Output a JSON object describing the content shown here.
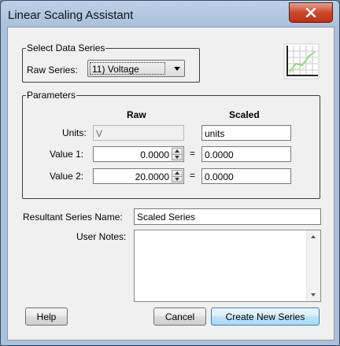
{
  "window": {
    "title": "Linear Scaling Assistant"
  },
  "select_series": {
    "legend": "Select Data Series",
    "raw_series_label": "Raw Series:",
    "raw_series_value": "11) Voltage"
  },
  "parameters": {
    "legend": "Parameters",
    "raw_header": "Raw",
    "scaled_header": "Scaled",
    "units_label": "Units:",
    "units_raw": "V",
    "units_scaled": "units",
    "value1_label": "Value 1:",
    "value1_raw": "0.0000",
    "value1_scaled": "0.0000",
    "value2_label": "Value 2:",
    "value2_raw": "20.0000",
    "value2_scaled": "0.0000",
    "equals": "="
  },
  "result": {
    "label": "Resultant Series Name:",
    "value": "Scaled Series"
  },
  "notes": {
    "label": "User Notes:",
    "value": ""
  },
  "buttons": {
    "help": "Help",
    "cancel": "Cancel",
    "create": "Create New Series"
  },
  "icons": {
    "close": "close-icon",
    "chart": "line-chart-icon"
  }
}
